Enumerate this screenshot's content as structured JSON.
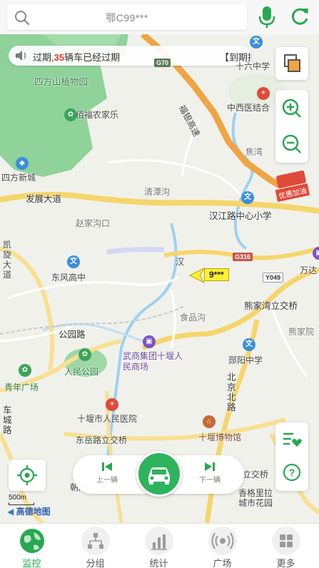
{
  "search": {
    "query": "鄂C99***"
  },
  "notice": {
    "prefix": "过期,",
    "count": "35",
    "suffix": "辆车已经过期",
    "tail": "【到期提"
  },
  "map": {
    "labels": {
      "park1": "四方山植物园",
      "farm": "佰福农家乐",
      "sifang": "四方新城",
      "fazhan": "发展大道",
      "qingtan": "清潭沟",
      "zhaojia": "赵家沟口",
      "kaixuan": "凯旋大道",
      "dongfeng": "东风高中",
      "hanjiang": "汉江路中心小学",
      "wanda": "万达",
      "xiongjia": "熊家湾立交桥",
      "xiongjia2": "熊家院",
      "shipin": "食品沟",
      "gongyuan": "公园路",
      "wushang": "武商集团十堰人民商场",
      "renmin": "人民公园",
      "qingnian": "青年广场",
      "yunyang": "郧阳中学",
      "beijing": "北京北路",
      "chengpu": "车城路",
      "hospital": "十堰市人民医院",
      "dongyue": "东岳路立交桥",
      "museum": "十堰博物馆",
      "lijiao": "立交桥",
      "xiangge": "香格里拉城市花园",
      "zhongyi": "中西医结合",
      "shiliu": "十六中学",
      "jiao": "焦湾",
      "highway": "福银高速",
      "oil": "优惠加油",
      "chaoyang": "朝阳",
      "han": "汉",
      "g70": "G70",
      "g316": "G316",
      "y049": "Y049"
    },
    "vehicle_tag": "9***",
    "scale": "500m",
    "provider": "高德地图"
  },
  "player": {
    "prev_label": "上一辆",
    "next_label": "下一辆"
  },
  "tabs": [
    {
      "label": "监控",
      "active": true
    },
    {
      "label": "分组"
    },
    {
      "label": "统计"
    },
    {
      "label": "广场"
    },
    {
      "label": "更多"
    }
  ],
  "colors": {
    "accent": "#27a84f",
    "alert": "#e03a2a",
    "vehicle": "#fff033"
  }
}
